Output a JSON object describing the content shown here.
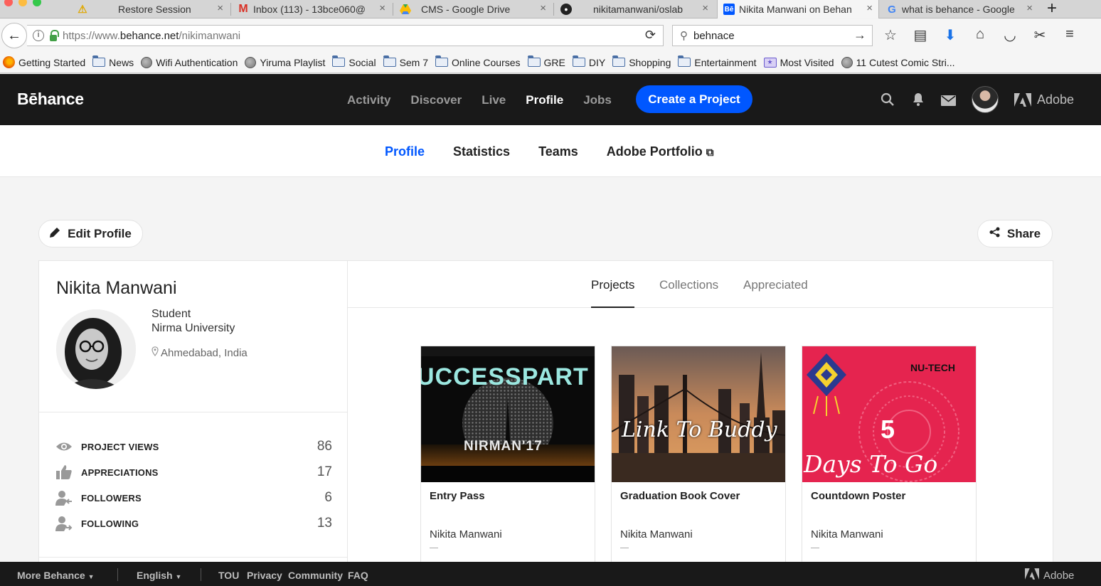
{
  "browser": {
    "tabs": [
      {
        "title": "Restore Session",
        "icon": "warning-icon"
      },
      {
        "title": "Inbox (113) - 13bce060@",
        "icon": "gmail-icon"
      },
      {
        "title": "CMS - Google Drive",
        "icon": "google-drive-icon"
      },
      {
        "title": "nikitamanwani/oslab",
        "icon": "github-icon"
      },
      {
        "title": "Nikita Manwani on Behan",
        "icon": "behance-icon",
        "active": true
      },
      {
        "title": "what is behance - Google",
        "icon": "google-icon"
      }
    ],
    "url_prefix": "https://www.",
    "url_domain": "behance.net",
    "url_path": "/nikimanwani",
    "search_value": "behnace",
    "bookmarks": [
      {
        "label": "Getting Started",
        "icon": "firefox-icon"
      },
      {
        "label": "News",
        "icon": "folder-icon"
      },
      {
        "label": "Wifi Authentication",
        "icon": "globe-icon"
      },
      {
        "label": "Yiruma Playlist",
        "icon": "globe-icon"
      },
      {
        "label": "Social",
        "icon": "folder-icon"
      },
      {
        "label": "Sem 7",
        "icon": "folder-icon"
      },
      {
        "label": "Online Courses",
        "icon": "folder-icon"
      },
      {
        "label": "GRE",
        "icon": "folder-icon"
      },
      {
        "label": "DIY",
        "icon": "folder-icon"
      },
      {
        "label": "Shopping",
        "icon": "folder-icon"
      },
      {
        "label": "Entertainment",
        "icon": "folder-icon"
      },
      {
        "label": "Most Visited",
        "icon": "smart-folder-icon"
      },
      {
        "label": "11 Cutest Comic Stri...",
        "icon": "globe-icon"
      }
    ]
  },
  "behance": {
    "logo": "Bēhance",
    "nav": [
      {
        "label": "Activity",
        "active": false
      },
      {
        "label": "Discover",
        "active": false
      },
      {
        "label": "Live",
        "active": false
      },
      {
        "label": "Profile",
        "active": true
      },
      {
        "label": "Jobs",
        "active": false
      }
    ],
    "create_label": "Create a Project",
    "adobe_label": "Adobe",
    "accent_color": "#0057ff",
    "subnav": [
      {
        "label": "Profile",
        "active": true
      },
      {
        "label": "Statistics",
        "active": false
      },
      {
        "label": "Teams",
        "active": false
      },
      {
        "label": "Adobe Portfolio",
        "active": false,
        "external": true
      }
    ],
    "edit_profile_label": "Edit Profile",
    "share_label": "Share"
  },
  "profile": {
    "name": "Nikita Manwani",
    "occupation": "Student",
    "company": "Nirma University",
    "location": "Ahmedabad, India",
    "stats": [
      {
        "label": "PROJECT VIEWS",
        "value": "86",
        "icon": "eye-icon"
      },
      {
        "label": "APPRECIATIONS",
        "value": "17",
        "icon": "thumbs-up-icon"
      },
      {
        "label": "FOLLOWERS",
        "value": "6",
        "icon": "followers-icon"
      },
      {
        "label": "FOLLOWING",
        "value": "13",
        "icon": "following-icon"
      }
    ]
  },
  "projects": {
    "tabs": [
      {
        "label": "Projects",
        "active": true
      },
      {
        "label": "Collections",
        "active": false
      },
      {
        "label": "Appreciated",
        "active": false
      }
    ],
    "items": [
      {
        "title": "Entry Pass",
        "owner": "Nikita Manwani",
        "thumb_text": "UCCESSPART",
        "thumb_sub": "NIRMAN'17"
      },
      {
        "title": "Graduation Book Cover",
        "owner": "Nikita Manwani",
        "thumb_text": "Link To Buddy"
      },
      {
        "title": "Countdown Poster",
        "owner": "Nikita Manwani",
        "thumb_text": "Days To Go",
        "thumb_number": "5",
        "thumb_brand": "NU-TECH"
      }
    ]
  },
  "footer": {
    "more_label": "More Behance",
    "language_label": "English",
    "links": [
      "TOU",
      "Privacy",
      "Community",
      "FAQ"
    ],
    "adobe_label": "Adobe"
  }
}
